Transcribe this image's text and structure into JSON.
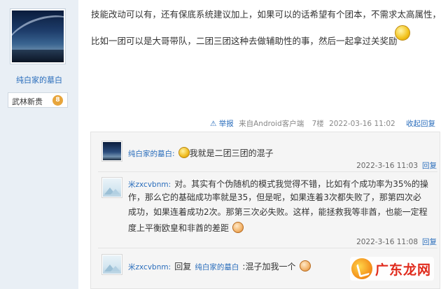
{
  "sidebar": {
    "username": "纯白家的墓白",
    "rank_label": "武林新贵",
    "rank_level": "8",
    "avatar_icon": "starry-sky-avatar"
  },
  "post": {
    "lines": [
      "技能改动可以有，还有保底系统建议加上，如果可以的话希望有个团本，不需求太高属性，",
      "比如一团可以是大哥带队，二团三团这种去做辅助性的事，然后一起拿过关奖励"
    ],
    "report_label": "举报",
    "source": "来自Android客户端",
    "floor": "7楼",
    "timestamp": "2022-03-16 11:02",
    "collapse_label": "收起回复"
  },
  "replies": [
    {
      "user": "纯白家的墓白:",
      "text": "我就是二团三团的混子",
      "time": "2022-3-16 11:03",
      "reply_label": "回复",
      "avatar_icon": "starry-sky-avatar"
    },
    {
      "user": "米zxcvbnm:",
      "lines": [
        "对。其实有个伪随机的模式我觉得不错，比如有个成功率为35%的操",
        "作，那么它的基础成功率就是35，但是呢，如果连着3次都失败了，那第四次必",
        "成功，如果连着成功2次。那第三次必失败。这样，能拯救我等非酋，也能一定程",
        "度上平衡欧皇和非酋的差距"
      ],
      "time": "2022-3-16 11:08",
      "reply_label": "回复",
      "avatar_icon": "mountain-avatar"
    },
    {
      "user": "米zxcvbnm:",
      "reply_prefix": "回复",
      "reply_target": "纯白家的墓白",
      "text": ":混子加我一个",
      "avatar_icon": "mountain-avatar"
    }
  ],
  "watermark": {
    "text": "广东龙网"
  },
  "colors": {
    "link": "#2b6ebc",
    "sidebar_bg": "#e9eff5",
    "reply_bg": "#f5f5f5",
    "watermark": "#e02b1d"
  }
}
